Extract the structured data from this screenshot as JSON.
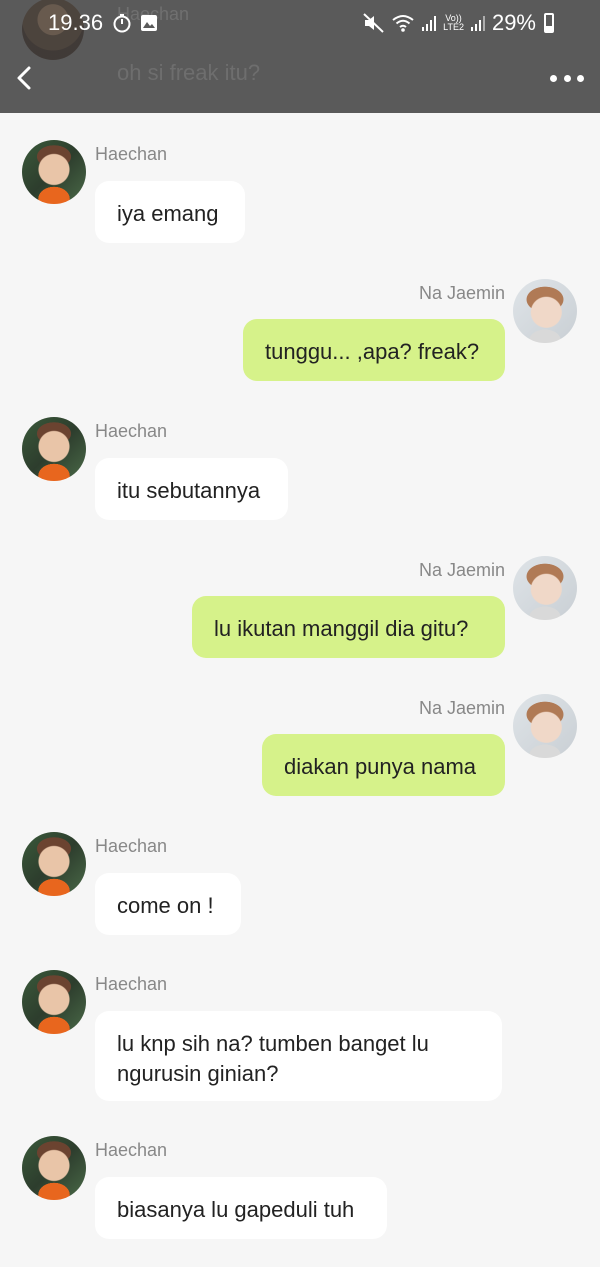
{
  "status_bar": {
    "time": "19.36",
    "battery": "29%",
    "network": "LTE2",
    "volte": "Vo))"
  },
  "header": {
    "ghost_name": "Haechan",
    "ghost_message": "oh si freak itu?"
  },
  "colors": {
    "header_bg": "#5a5a5a",
    "page_bg": "#f6f6f6",
    "outgoing_bubble": "#d6f28a",
    "incoming_bubble": "#ffffff"
  },
  "icons": {
    "back": "chevron-left-icon",
    "more": "more-horizontal-icon"
  },
  "messages": [
    {
      "sender": "Haechan",
      "side": "left",
      "text": "iya emang"
    },
    {
      "sender": "Na Jaemin",
      "side": "right",
      "text": "tunggu... ,apa? freak?"
    },
    {
      "sender": "Haechan",
      "side": "left",
      "text": "itu sebutannya"
    },
    {
      "sender": "Na Jaemin",
      "side": "right",
      "text": "lu ikutan manggil dia gitu?"
    },
    {
      "sender": "Na Jaemin",
      "side": "right",
      "text": "diakan punya nama"
    },
    {
      "sender": "Haechan",
      "side": "left",
      "text": "come on !"
    },
    {
      "sender": "Haechan",
      "side": "left",
      "text": "lu knp sih na? tumben banget lu ngurusin ginian?"
    },
    {
      "sender": "Haechan",
      "side": "left",
      "text": "biasanya lu gapeduli tuh"
    }
  ]
}
